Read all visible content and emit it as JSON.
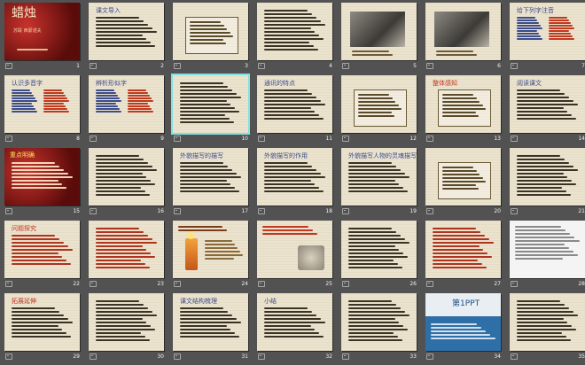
{
  "sorter": {
    "slides": [
      {
        "n": "1",
        "title": "蜡烛",
        "sub": "苏联 西蒙诺夫",
        "variant": "red"
      },
      {
        "n": "2",
        "title": "课文导入",
        "variant": "paper-title-text"
      },
      {
        "n": "3",
        "title": "",
        "variant": "paper-box"
      },
      {
        "n": "4",
        "title": "",
        "variant": "paper-dense"
      },
      {
        "n": "5",
        "title": "",
        "variant": "photo"
      },
      {
        "n": "6",
        "title": "",
        "variant": "photo2"
      },
      {
        "n": "7",
        "title": "给下列字注音",
        "variant": "pinyin"
      },
      {
        "n": "8",
        "title": "认识多音字",
        "variant": "columns"
      },
      {
        "n": "9",
        "title": "辨析形似字",
        "variant": "columns2"
      },
      {
        "n": "10",
        "title": "",
        "variant": "paper-selected"
      },
      {
        "n": "11",
        "title": "通讯的特点",
        "variant": "paper-list"
      },
      {
        "n": "12",
        "title": "",
        "variant": "paper-q"
      },
      {
        "n": "13",
        "title": "整体感知",
        "variant": "paper-box2"
      },
      {
        "n": "14",
        "title": "阅读课文",
        "variant": "paper-read"
      },
      {
        "n": "15",
        "title": "重点明确",
        "variant": "red-text"
      },
      {
        "n": "16",
        "title": "",
        "variant": "paper-dense"
      },
      {
        "n": "17",
        "title": "外貌描写的描写",
        "variant": "paper-heading"
      },
      {
        "n": "18",
        "title": "外貌描写的作用",
        "variant": "paper-heading"
      },
      {
        "n": "19",
        "title": "外貌描写人物的灵魂描写",
        "variant": "paper-heading2"
      },
      {
        "n": "20",
        "title": "",
        "variant": "paper-q2"
      },
      {
        "n": "21",
        "title": "",
        "variant": "paper-q3"
      },
      {
        "n": "22",
        "title": "问题探究",
        "variant": "paper-red-text"
      },
      {
        "n": "23",
        "title": "",
        "variant": "paper-red-lines"
      },
      {
        "n": "24",
        "title": "",
        "variant": "candle"
      },
      {
        "n": "25",
        "title": "",
        "variant": "paper-photo"
      },
      {
        "n": "26",
        "title": "",
        "variant": "paper-q4"
      },
      {
        "n": "27",
        "title": "",
        "variant": "paper-red-lines2"
      },
      {
        "n": "28",
        "title": "",
        "variant": "white-text"
      },
      {
        "n": "29",
        "title": "拓展延伸",
        "variant": "paper-orange"
      },
      {
        "n": "30",
        "title": "",
        "variant": "paper-dense2"
      },
      {
        "n": "31",
        "title": "课文结构梳理",
        "variant": "paper-outline"
      },
      {
        "n": "32",
        "title": "小结",
        "variant": "paper-summary"
      },
      {
        "n": "33",
        "title": "",
        "variant": "paper-list2"
      },
      {
        "n": "34",
        "title": "第1PPT",
        "variant": "ad"
      },
      {
        "n": "35",
        "title": "",
        "variant": "paper-q5"
      }
    ],
    "selected": "10"
  },
  "colors": {
    "background": "#525252",
    "selection": "#7fe3e3",
    "slide_number": "#f2f2f2"
  }
}
